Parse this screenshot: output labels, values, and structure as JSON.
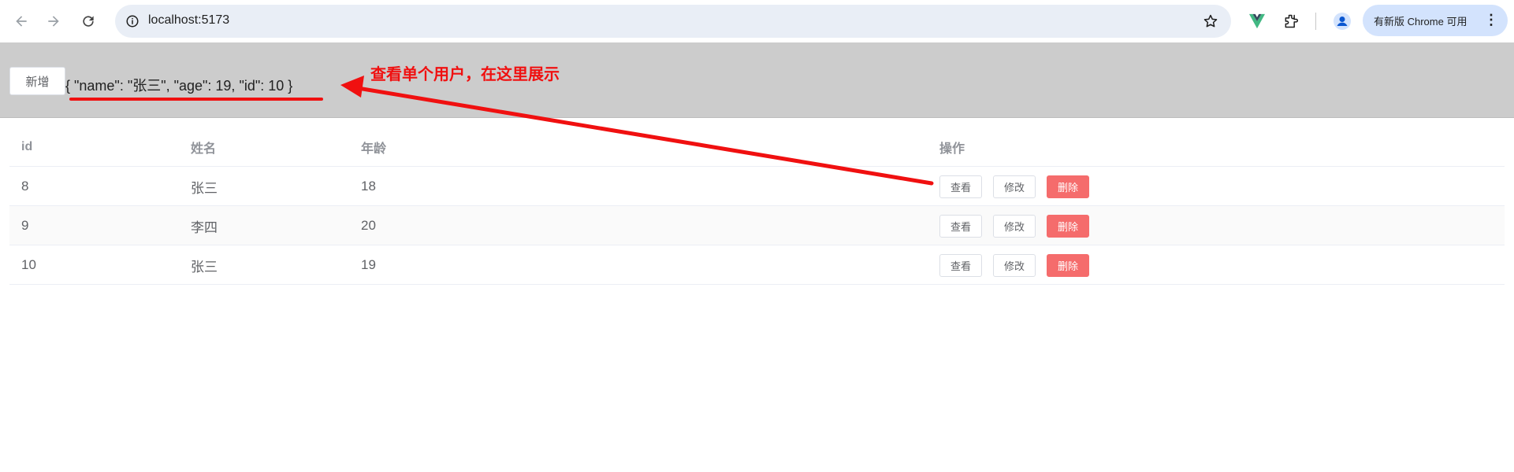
{
  "browser": {
    "url": "localhost:5173",
    "update_label": "有新版 Chrome 可用",
    "icons": [
      "back-arrow-icon",
      "forward-arrow-icon",
      "reload-icon",
      "site-info-icon",
      "star-icon",
      "vue-devtools-icon",
      "extensions-puzzle-icon",
      "profile-icon",
      "more-vert-icon"
    ]
  },
  "header": {
    "add_button": "新增",
    "selected_json": "{ \"name\": \"张三\", \"age\": 19, \"id\": 10 }"
  },
  "annotation": {
    "text": "查看单个用户，在这里展示",
    "color": "#f01010"
  },
  "table": {
    "columns": [
      "id",
      "姓名",
      "年龄",
      "操作"
    ],
    "rows": [
      {
        "id": "8",
        "name": "张三",
        "age": "18"
      },
      {
        "id": "9",
        "name": "李四",
        "age": "20"
      },
      {
        "id": "10",
        "name": "张三",
        "age": "19"
      }
    ],
    "actions": {
      "view": "查看",
      "edit": "修改",
      "delete": "删除"
    }
  },
  "colors": {
    "header_bg": "#cccccc",
    "danger": "#f56c6c",
    "omnibox_bg": "#e9eef6",
    "update_pill_bg": "#d3e3fd"
  }
}
